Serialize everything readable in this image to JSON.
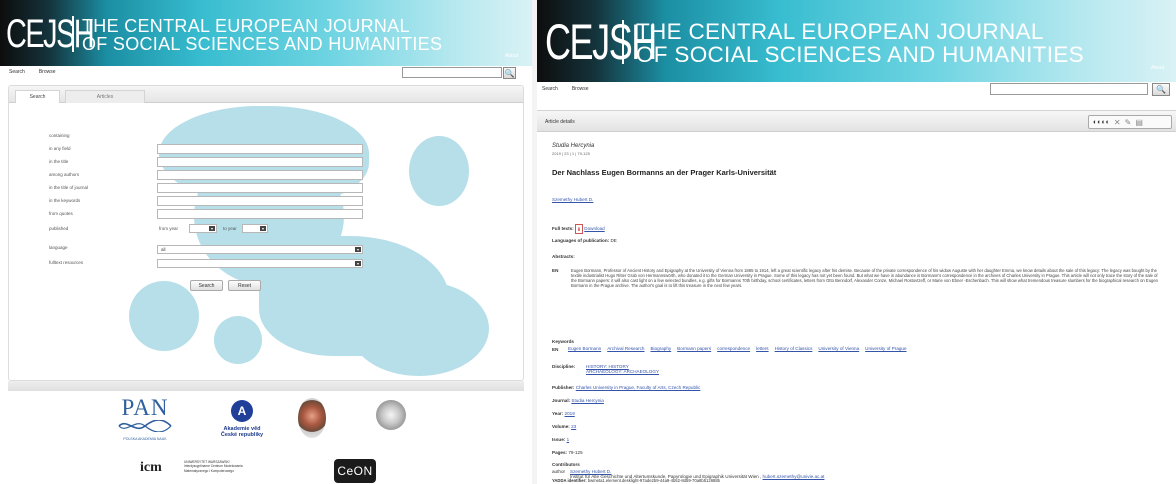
{
  "journal": {
    "logo": "CEJSH",
    "title_line1": "THE CENTRAL EUROPEAN JOURNAL",
    "title_line2": "OF SOCIAL SCIENCES AND HUMANITIES",
    "about": "About"
  },
  "nav": {
    "search": "Search",
    "browse": "Browse",
    "search_button": "🔍"
  },
  "colors": {
    "link": "#3354a8",
    "blob": "#b6dfe9",
    "banner_start": "#0d0d0d",
    "banner_end": "#d9f2f5"
  },
  "left": {
    "tabs": {
      "search": "Search",
      "articles": "Articles"
    },
    "form_labels": {
      "containing": "containing",
      "any_field": "in any field",
      "title": "in the title",
      "among_authors": "among authors",
      "journal_title": "in the title of journal",
      "keywords": "in the keywords",
      "from_quotes": "from quotes",
      "published": "published",
      "language": "language",
      "fulltext": "fulltext resources"
    },
    "published": {
      "from_year": "from year",
      "to_year": "to year"
    },
    "language_value": "all",
    "buttons": {
      "search": "Search",
      "reset": "Reset"
    },
    "logos": {
      "pan": "PAN",
      "pan_caption": "POLSKA AKADEMIA NAUK",
      "academy_line1": "Akademie věd",
      "academy_line2": "České republiky",
      "icm_mark": "icm",
      "icm_line1": "UNIWERSYTET WARSZAWSKI",
      "icm_line2": "Interdyscyplinarne Centrum Modelowania",
      "icm_line3": "Matematycznego i Komputerowego",
      "ceon": "CeON"
    }
  },
  "right": {
    "details_label": "Article details",
    "tools_glyphs": "◐◐◐◐",
    "series": "Studia Hercynia",
    "meta": "2019 | 23 | 1 | 79-125",
    "title": "Der Nachlass Eugen Bormanns an der Prager Karls-Universität",
    "author": "Szemethy Hubert D.",
    "full_texts_label": "Full texts:",
    "download": "Download",
    "languages_label": "Languages of publication:",
    "language": "DE",
    "abstracts_label": "Abstracts:",
    "abstract_lang": "EN",
    "abstract": "Eugen Bormann, Professor of Ancient History and Epigraphy at the University of Vienna from 1885 to 1914, left a great scientific legacy after his demise. Because of the private correspondence of his widow Auguste with her daughter Emma, we know details about the sale of this legacy: The legacy was bought by the textile industrialist Hugo Ritter Grab von Hermannswörth, who donated it to the German University in Prague. Some of this legacy has not yet been found. But what we have in abundance is Bormann's correspondence in the archives of Charles University in Prague. This article will not only trace the story of the sale of the Bormann papers: it will also cast light on a few selected bundles, e.g. gifts for Bormanns 70th birthday, school certificates, letters from Otto Benndorf, Alexander Conze, Michael Rostovtzeff, or Marie von Ebner -Eschenbach. This will show what tremendous treasure slumbers for the biographical research on Eugen Bormann in the Prague archive. The author's goal is to lift this treasure in the next few years.",
    "keywords_label": "Keywords",
    "keywords_lang": "EN",
    "keywords": [
      "Eugen Bormann",
      "Archival Research",
      "Biography",
      "Bormann papers",
      "correspondence",
      "letters",
      "History of Classics",
      "University of Vienna",
      "University of Prague"
    ],
    "discipline_label": "Discipline:",
    "discipline_1": "HISTORY: HISTORY",
    "discipline_2": "ARCHAEOLOGY: ARCHAEOLOGY",
    "publisher_label": "Publisher:",
    "publisher": "Charles University in Prague, Faculty of Arts, Czech Republic",
    "journal_label": "Journal:",
    "journal": "Studia Hercynia",
    "year_label": "Year:",
    "year": "2019",
    "volume_label": "Volume:",
    "volume": "23",
    "issue_label": "Issue:",
    "issue": "1",
    "pages_label": "Pages:",
    "pages": "79-125",
    "contributors_label": "Contributors",
    "contrib_role": "author",
    "contrib_name": "Szemethy Hubert D.",
    "contrib_affil": "Institut für Alte Geschichte und Altertumskunde, Papyrologie und Epigraphik Universität Wien ,",
    "contrib_email": "hubert.szemethy@univie.ac.at",
    "bwmeta_label": "YADDA identifier:",
    "bwmeta": "bwmeta1.element.desklight-97ade2b9-44a9-4b52-8d59-70a8b512688b"
  }
}
